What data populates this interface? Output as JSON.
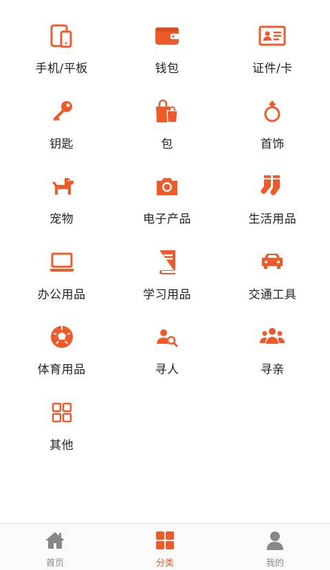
{
  "accent_color": "#f05a28",
  "categories": [
    {
      "label": "手机/平板",
      "icon": "tablet-phone-icon"
    },
    {
      "label": "钱包",
      "icon": "wallet-icon"
    },
    {
      "label": "证件/卡",
      "icon": "id-card-icon"
    },
    {
      "label": "钥匙",
      "icon": "key-icon"
    },
    {
      "label": "包",
      "icon": "shopping-bag-icon"
    },
    {
      "label": "首饰",
      "icon": "ring-icon"
    },
    {
      "label": "宠物",
      "icon": "dog-icon"
    },
    {
      "label": "电子产品",
      "icon": "camera-icon"
    },
    {
      "label": "生活用品",
      "icon": "socks-icon"
    },
    {
      "label": "办公用品",
      "icon": "laptop-icon"
    },
    {
      "label": "学习用品",
      "icon": "book-icon"
    },
    {
      "label": "交通工具",
      "icon": "car-icon"
    },
    {
      "label": "体育用品",
      "icon": "soccer-ball-icon"
    },
    {
      "label": "寻人",
      "icon": "person-search-icon"
    },
    {
      "label": "寻亲",
      "icon": "group-icon"
    },
    {
      "label": "其他",
      "icon": "grid-icon"
    }
  ],
  "tabbar": {
    "tabs": [
      {
        "label": "首页",
        "icon": "home-icon",
        "active": false
      },
      {
        "label": "分类",
        "icon": "category-grid-icon",
        "active": true
      },
      {
        "label": "我的",
        "icon": "user-icon",
        "active": false
      }
    ]
  }
}
